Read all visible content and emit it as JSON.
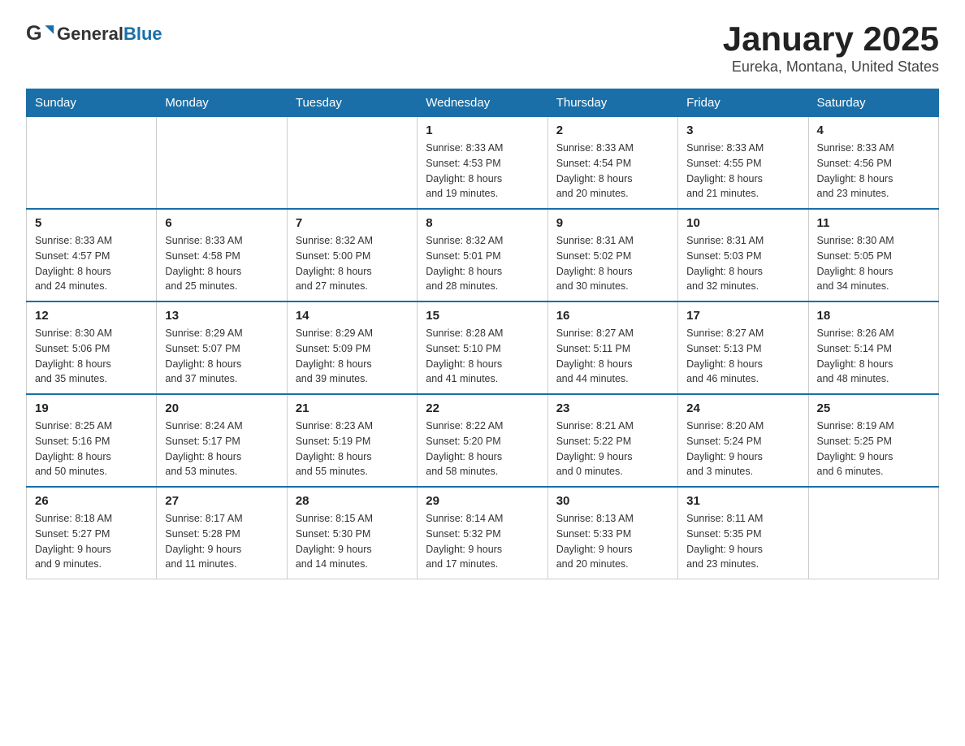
{
  "logo": {
    "general": "General",
    "blue": "Blue"
  },
  "title": "January 2025",
  "subtitle": "Eureka, Montana, United States",
  "days_of_week": [
    "Sunday",
    "Monday",
    "Tuesday",
    "Wednesday",
    "Thursday",
    "Friday",
    "Saturday"
  ],
  "weeks": [
    [
      {
        "day": "",
        "info": ""
      },
      {
        "day": "",
        "info": ""
      },
      {
        "day": "",
        "info": ""
      },
      {
        "day": "1",
        "info": "Sunrise: 8:33 AM\nSunset: 4:53 PM\nDaylight: 8 hours\nand 19 minutes."
      },
      {
        "day": "2",
        "info": "Sunrise: 8:33 AM\nSunset: 4:54 PM\nDaylight: 8 hours\nand 20 minutes."
      },
      {
        "day": "3",
        "info": "Sunrise: 8:33 AM\nSunset: 4:55 PM\nDaylight: 8 hours\nand 21 minutes."
      },
      {
        "day": "4",
        "info": "Sunrise: 8:33 AM\nSunset: 4:56 PM\nDaylight: 8 hours\nand 23 minutes."
      }
    ],
    [
      {
        "day": "5",
        "info": "Sunrise: 8:33 AM\nSunset: 4:57 PM\nDaylight: 8 hours\nand 24 minutes."
      },
      {
        "day": "6",
        "info": "Sunrise: 8:33 AM\nSunset: 4:58 PM\nDaylight: 8 hours\nand 25 minutes."
      },
      {
        "day": "7",
        "info": "Sunrise: 8:32 AM\nSunset: 5:00 PM\nDaylight: 8 hours\nand 27 minutes."
      },
      {
        "day": "8",
        "info": "Sunrise: 8:32 AM\nSunset: 5:01 PM\nDaylight: 8 hours\nand 28 minutes."
      },
      {
        "day": "9",
        "info": "Sunrise: 8:31 AM\nSunset: 5:02 PM\nDaylight: 8 hours\nand 30 minutes."
      },
      {
        "day": "10",
        "info": "Sunrise: 8:31 AM\nSunset: 5:03 PM\nDaylight: 8 hours\nand 32 minutes."
      },
      {
        "day": "11",
        "info": "Sunrise: 8:30 AM\nSunset: 5:05 PM\nDaylight: 8 hours\nand 34 minutes."
      }
    ],
    [
      {
        "day": "12",
        "info": "Sunrise: 8:30 AM\nSunset: 5:06 PM\nDaylight: 8 hours\nand 35 minutes."
      },
      {
        "day": "13",
        "info": "Sunrise: 8:29 AM\nSunset: 5:07 PM\nDaylight: 8 hours\nand 37 minutes."
      },
      {
        "day": "14",
        "info": "Sunrise: 8:29 AM\nSunset: 5:09 PM\nDaylight: 8 hours\nand 39 minutes."
      },
      {
        "day": "15",
        "info": "Sunrise: 8:28 AM\nSunset: 5:10 PM\nDaylight: 8 hours\nand 41 minutes."
      },
      {
        "day": "16",
        "info": "Sunrise: 8:27 AM\nSunset: 5:11 PM\nDaylight: 8 hours\nand 44 minutes."
      },
      {
        "day": "17",
        "info": "Sunrise: 8:27 AM\nSunset: 5:13 PM\nDaylight: 8 hours\nand 46 minutes."
      },
      {
        "day": "18",
        "info": "Sunrise: 8:26 AM\nSunset: 5:14 PM\nDaylight: 8 hours\nand 48 minutes."
      }
    ],
    [
      {
        "day": "19",
        "info": "Sunrise: 8:25 AM\nSunset: 5:16 PM\nDaylight: 8 hours\nand 50 minutes."
      },
      {
        "day": "20",
        "info": "Sunrise: 8:24 AM\nSunset: 5:17 PM\nDaylight: 8 hours\nand 53 minutes."
      },
      {
        "day": "21",
        "info": "Sunrise: 8:23 AM\nSunset: 5:19 PM\nDaylight: 8 hours\nand 55 minutes."
      },
      {
        "day": "22",
        "info": "Sunrise: 8:22 AM\nSunset: 5:20 PM\nDaylight: 8 hours\nand 58 minutes."
      },
      {
        "day": "23",
        "info": "Sunrise: 8:21 AM\nSunset: 5:22 PM\nDaylight: 9 hours\nand 0 minutes."
      },
      {
        "day": "24",
        "info": "Sunrise: 8:20 AM\nSunset: 5:24 PM\nDaylight: 9 hours\nand 3 minutes."
      },
      {
        "day": "25",
        "info": "Sunrise: 8:19 AM\nSunset: 5:25 PM\nDaylight: 9 hours\nand 6 minutes."
      }
    ],
    [
      {
        "day": "26",
        "info": "Sunrise: 8:18 AM\nSunset: 5:27 PM\nDaylight: 9 hours\nand 9 minutes."
      },
      {
        "day": "27",
        "info": "Sunrise: 8:17 AM\nSunset: 5:28 PM\nDaylight: 9 hours\nand 11 minutes."
      },
      {
        "day": "28",
        "info": "Sunrise: 8:15 AM\nSunset: 5:30 PM\nDaylight: 9 hours\nand 14 minutes."
      },
      {
        "day": "29",
        "info": "Sunrise: 8:14 AM\nSunset: 5:32 PM\nDaylight: 9 hours\nand 17 minutes."
      },
      {
        "day": "30",
        "info": "Sunrise: 8:13 AM\nSunset: 5:33 PM\nDaylight: 9 hours\nand 20 minutes."
      },
      {
        "day": "31",
        "info": "Sunrise: 8:11 AM\nSunset: 5:35 PM\nDaylight: 9 hours\nand 23 minutes."
      },
      {
        "day": "",
        "info": ""
      }
    ]
  ]
}
